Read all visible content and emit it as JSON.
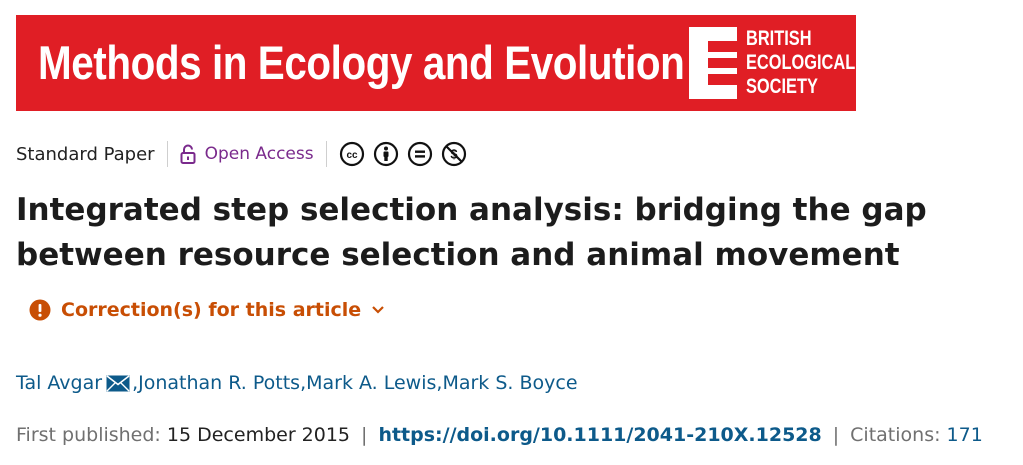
{
  "banner": {
    "journal_title": "Methods in Ecology and Evolution",
    "society_line1": "BRITISH",
    "society_line2": "ECOLOGICAL",
    "society_line3": "SOCIETY",
    "color": "#e01e25"
  },
  "meta": {
    "article_type": "Standard Paper",
    "open_access_label": "Open Access",
    "license_icons": [
      "cc-icon",
      "by-attribution-icon",
      "no-derivatives-icon",
      "non-commercial-icon"
    ]
  },
  "article": {
    "title": "Integrated step selection analysis: bridging the gap between resource selection and animal movement"
  },
  "correction": {
    "label": "Correction(s) for this article",
    "color": "#c84e04"
  },
  "authors": [
    {
      "name": "Tal Avgar",
      "corresponding": true
    },
    {
      "name": "Jonathan R. Potts",
      "corresponding": false
    },
    {
      "name": "Mark A. Lewis",
      "corresponding": false
    },
    {
      "name": "Mark S. Boyce",
      "corresponding": false
    }
  ],
  "author_separator": ", ",
  "publication": {
    "first_published_label": "First published:",
    "first_published_date": "15 December 2015",
    "separator": "|",
    "doi": "https://doi.org/10.1111/2041-210X.12528",
    "citations_label": "Citations:",
    "citations_count": "171"
  },
  "colors": {
    "link": "#0d5a8a",
    "open_access": "#7a2a8c"
  }
}
